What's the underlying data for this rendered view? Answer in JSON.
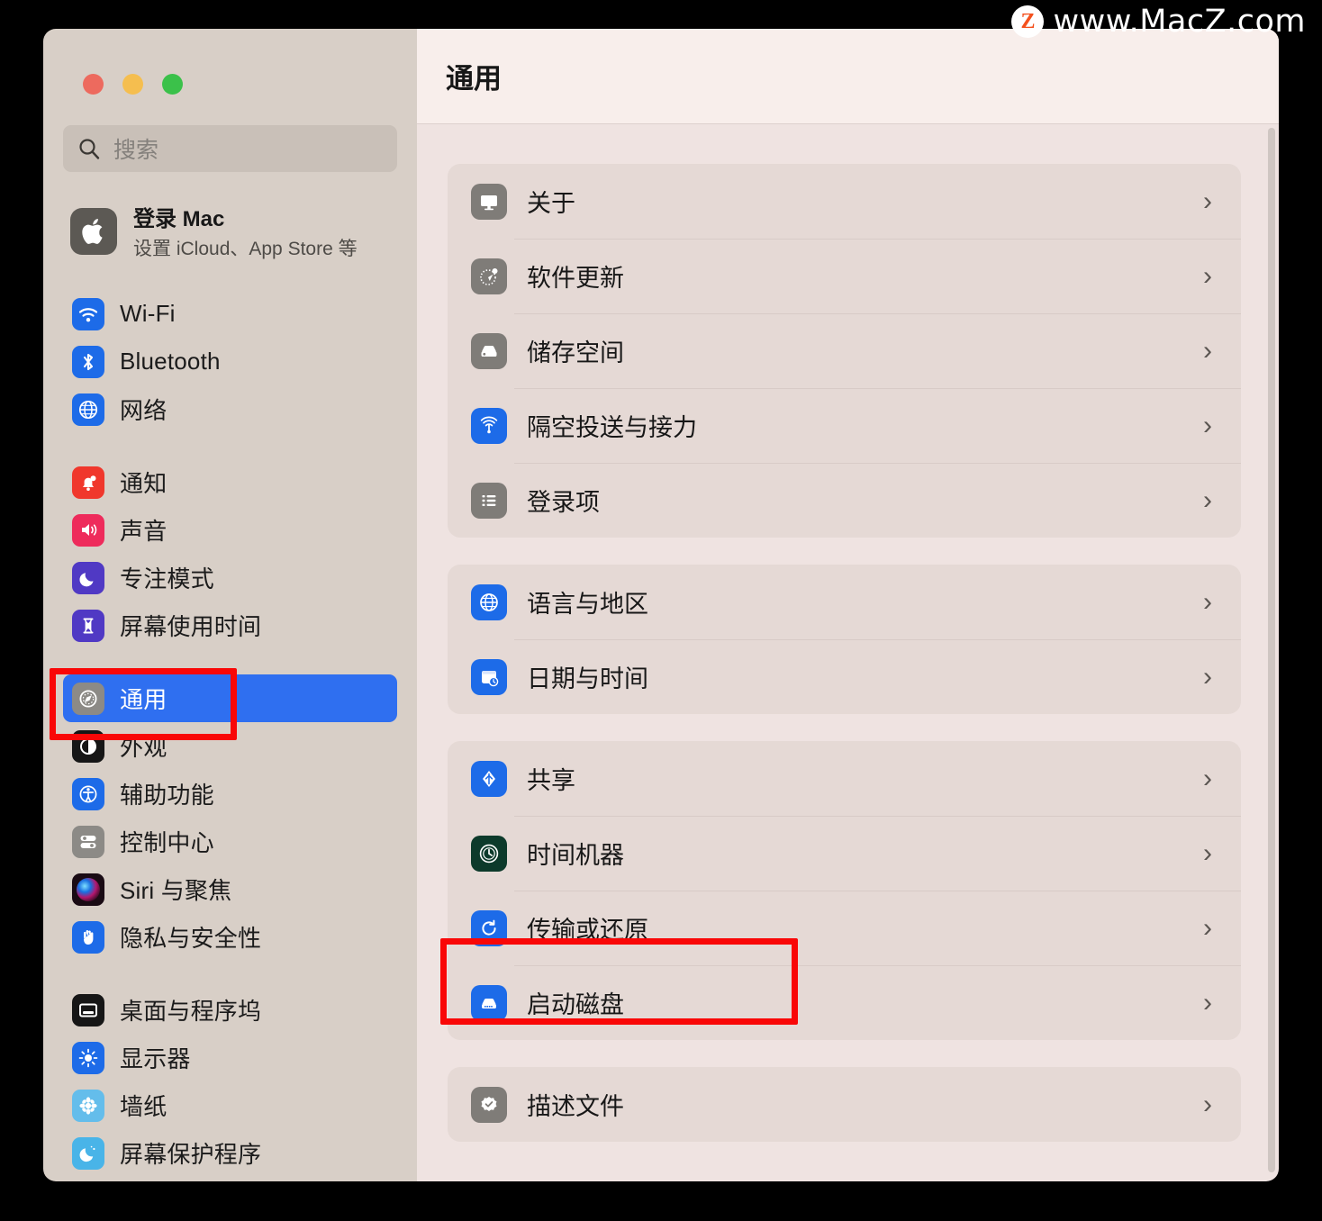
{
  "watermark": {
    "logo_letter": "Z",
    "text": "www.MacZ.com"
  },
  "window": {
    "traffic_lights": [
      "close",
      "minimize",
      "zoom"
    ],
    "colors": {
      "close": "#ED6A5E",
      "minimize": "#F5BE4F",
      "zoom": "#3BC14A",
      "accent": "#2F6FF0",
      "annotation": "#F90707"
    }
  },
  "sidebar": {
    "search": {
      "placeholder": "搜索",
      "value": ""
    },
    "account": {
      "title": "登录 Mac",
      "subtitle": "设置 iCloud、App Store 等",
      "icon": "apple-logo-icon"
    },
    "groups": [
      {
        "items": [
          {
            "label": "Wi-Fi",
            "icon": "wifi-icon",
            "selected": false
          },
          {
            "label": "Bluetooth",
            "icon": "bluetooth-icon",
            "selected": false
          },
          {
            "label": "网络",
            "icon": "network-globe-icon",
            "selected": false
          }
        ]
      },
      {
        "items": [
          {
            "label": "通知",
            "icon": "notifications-bell-icon",
            "selected": false
          },
          {
            "label": "声音",
            "icon": "sound-speaker-icon",
            "selected": false
          },
          {
            "label": "专注模式",
            "icon": "focus-moon-icon",
            "selected": false
          },
          {
            "label": "屏幕使用时间",
            "icon": "screen-time-hourglass-icon",
            "selected": false
          }
        ]
      },
      {
        "items": [
          {
            "label": "通用",
            "icon": "general-gear-icon",
            "selected": true
          },
          {
            "label": "外观",
            "icon": "appearance-contrast-icon",
            "selected": false
          },
          {
            "label": "辅助功能",
            "icon": "accessibility-icon",
            "selected": false
          },
          {
            "label": "控制中心",
            "icon": "control-center-icon",
            "selected": false
          },
          {
            "label": "Siri 与聚焦",
            "icon": "siri-spotlight-icon",
            "selected": false
          },
          {
            "label": "隐私与安全性",
            "icon": "privacy-hand-icon",
            "selected": false
          }
        ]
      },
      {
        "items": [
          {
            "label": "桌面与程序坞",
            "icon": "desktop-dock-icon",
            "selected": false
          },
          {
            "label": "显示器",
            "icon": "displays-brightness-icon",
            "selected": false
          },
          {
            "label": "墙纸",
            "icon": "wallpaper-icon",
            "selected": false
          },
          {
            "label": "屏幕保护程序",
            "icon": "screensaver-moon-icon",
            "selected": false
          }
        ]
      }
    ]
  },
  "main": {
    "title": "通用",
    "chevron": "›",
    "groups": [
      {
        "rows": [
          {
            "label": "关于",
            "icon": "about-monitor-icon",
            "highlighted": false
          },
          {
            "label": "软件更新",
            "icon": "software-update-icon",
            "highlighted": false
          },
          {
            "label": "储存空间",
            "icon": "storage-disk-icon",
            "highlighted": false
          },
          {
            "label": "隔空投送与接力",
            "icon": "airdrop-icon",
            "highlighted": false
          },
          {
            "label": "登录项",
            "icon": "login-items-list-icon",
            "highlighted": false
          }
        ]
      },
      {
        "rows": [
          {
            "label": "语言与地区",
            "icon": "language-globe-icon",
            "highlighted": false
          },
          {
            "label": "日期与时间",
            "icon": "date-time-icon",
            "highlighted": false
          }
        ]
      },
      {
        "rows": [
          {
            "label": "共享",
            "icon": "sharing-icon",
            "highlighted": false
          },
          {
            "label": "时间机器",
            "icon": "time-machine-icon",
            "highlighted": false
          },
          {
            "label": "传输或还原",
            "icon": "transfer-reset-icon",
            "highlighted": false
          },
          {
            "label": "启动磁盘",
            "icon": "startup-disk-icon",
            "highlighted": true
          }
        ]
      },
      {
        "rows": [
          {
            "label": "描述文件",
            "icon": "profiles-badge-icon",
            "highlighted": false
          }
        ]
      }
    ]
  }
}
